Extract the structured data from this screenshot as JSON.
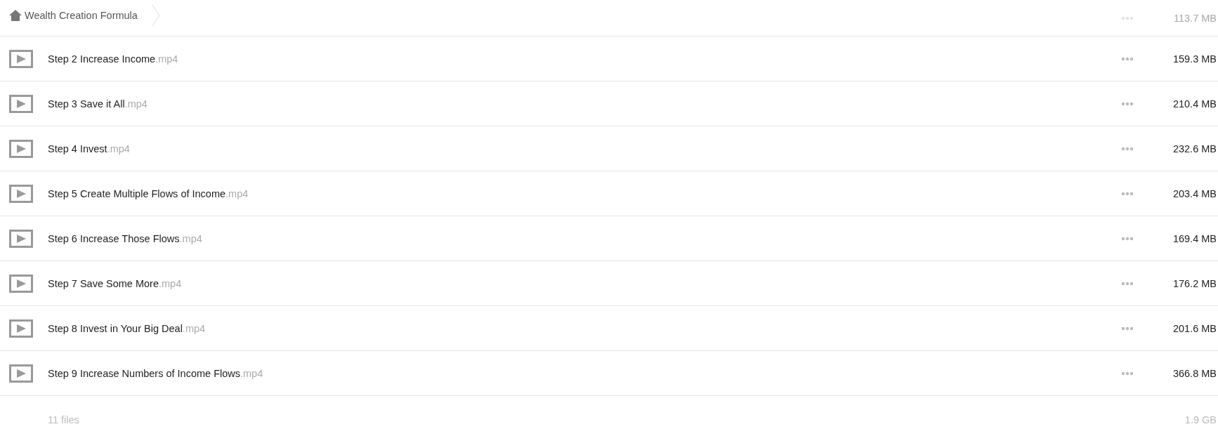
{
  "breadcrumb": {
    "title": "Wealth Creation Formula"
  },
  "faded_row": {
    "size": "113.7 MB"
  },
  "files": [
    {
      "name": "Step 2 Increase Income",
      "ext": ".mp4",
      "size": "159.3 MB"
    },
    {
      "name": "Step 3 Save it All",
      "ext": ".mp4",
      "size": "210.4 MB"
    },
    {
      "name": "Step 4 Invest",
      "ext": ".mp4",
      "size": "232.6 MB"
    },
    {
      "name": "Step 5 Create Multiple Flows of Income",
      "ext": ".mp4",
      "size": "203.4 MB"
    },
    {
      "name": "Step 6 Increase Those Flows",
      "ext": ".mp4",
      "size": "169.4 MB"
    },
    {
      "name": "Step 7 Save Some More",
      "ext": ".mp4",
      "size": "176.2 MB"
    },
    {
      "name": "Step 8 Invest in Your Big Deal",
      "ext": ".mp4",
      "size": "201.6 MB"
    },
    {
      "name": "Step 9 Increase Numbers of Income Flows",
      "ext": ".mp4",
      "size": "366.8 MB"
    }
  ],
  "footer": {
    "count": "11 files",
    "total": "1.9 GB"
  }
}
